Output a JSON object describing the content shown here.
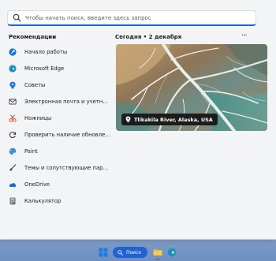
{
  "search": {
    "placeholder": "Чтобы начать поиск, введите здесь запрос",
    "icon": "search-icon"
  },
  "recommendations": {
    "title": "Рекомендации",
    "items": [
      {
        "label": "Начало работы",
        "icon": "get-started-icon"
      },
      {
        "label": "Microsoft Edge",
        "icon": "edge-icon"
      },
      {
        "label": "Советы",
        "icon": "tips-icon"
      },
      {
        "label": "Электронная почта и учетные ...",
        "icon": "mail-icon"
      },
      {
        "label": "Ножницы",
        "icon": "snipping-tool-icon"
      },
      {
        "label": "Проверить наличие обновлен...",
        "icon": "update-icon"
      },
      {
        "label": "Paint",
        "icon": "paint-icon"
      },
      {
        "label": "Темы и сопутствующие парам...",
        "icon": "brush-icon"
      },
      {
        "label": "OneDrive",
        "icon": "onedrive-icon"
      },
      {
        "label": "Калькулятор",
        "icon": "calculator-icon"
      }
    ]
  },
  "today": {
    "header": "Сегодня • 2 декабря",
    "more": "···",
    "caption": "Tlikakila River, Alaska, USA"
  },
  "taskbar": {
    "search_label": "Поиск",
    "accent": "#1f63d1"
  }
}
